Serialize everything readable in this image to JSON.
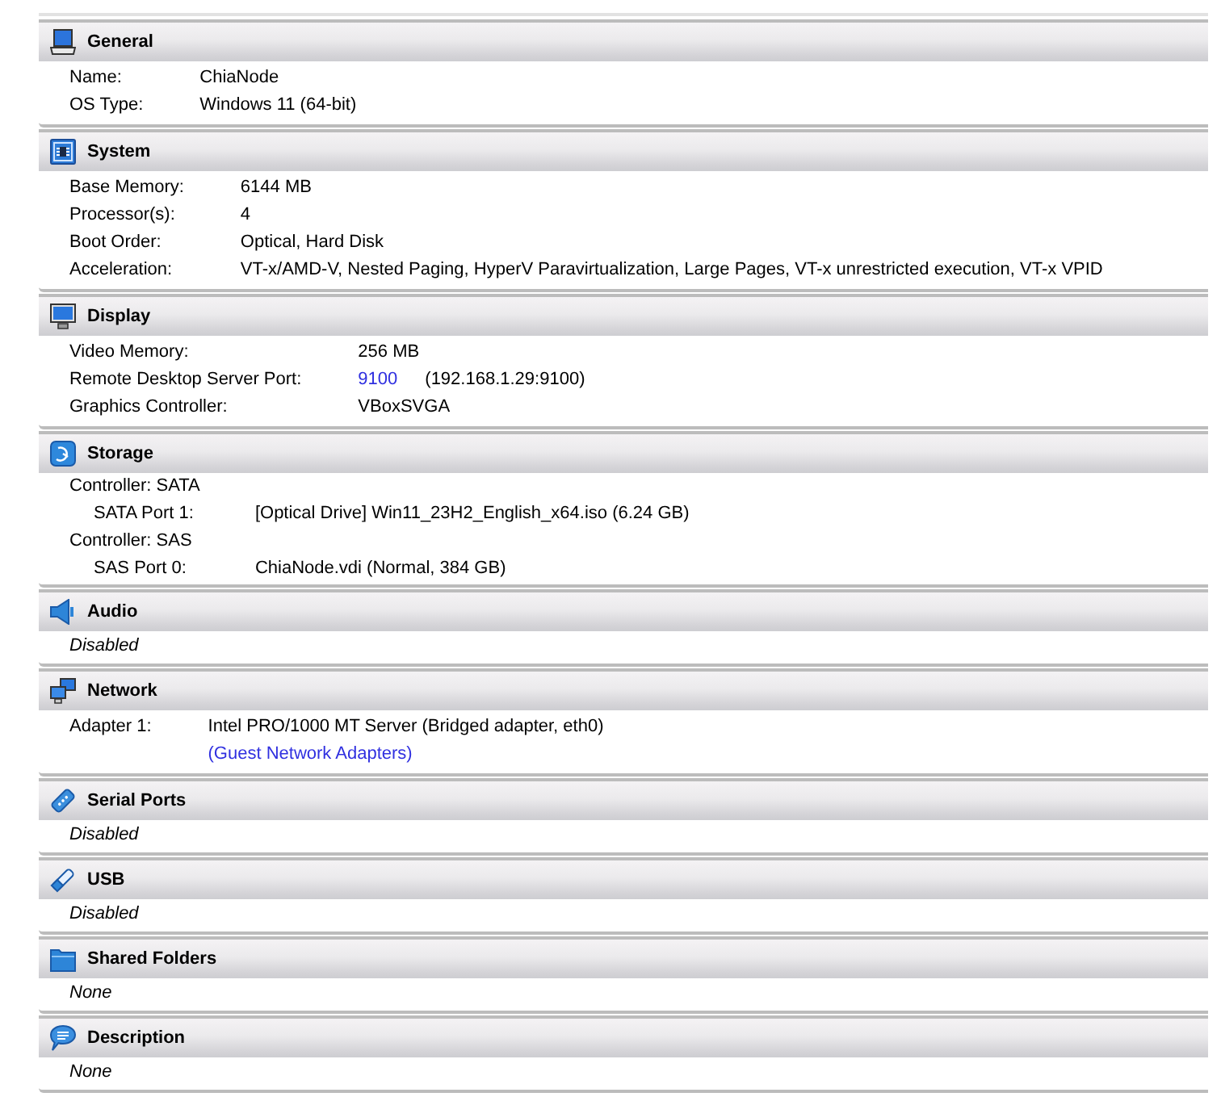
{
  "sections": [
    {
      "kind": "table",
      "title": "General",
      "rows": [
        {
          "label": "Name:",
          "value": "ChiaNode"
        },
        {
          "label": "OS Type:",
          "value": "Windows 11 (64-bit)"
        }
      ]
    },
    {
      "kind": "table",
      "title": "System",
      "rows": [
        {
          "label": "Base Memory:",
          "value": "6144 MB"
        },
        {
          "label": "Processor(s):",
          "value": "4"
        },
        {
          "label": "Boot Order:",
          "value": "Optical, Hard Disk"
        },
        {
          "label": "Acceleration:",
          "value": "VT-x/AMD-V, Nested Paging, HyperV Paravirtualization, Large Pages, VT-x unrestricted execution, VT-x VPID"
        }
      ]
    },
    {
      "kind": "table",
      "title": "Display",
      "rows": [
        {
          "label": "Video Memory:",
          "value": "256 MB",
          "link": false
        },
        {
          "label": "Remote Desktop Server Port:",
          "value": "9100",
          "link": true,
          "detail": "(192.168.1.29:9100)"
        },
        {
          "label": "Graphics Controller:",
          "value": "VBoxSVGA",
          "link": false
        }
      ]
    },
    {
      "kind": "tree",
      "title": "Storage",
      "controllers": [
        {
          "label": "Controller: SATA",
          "children": [
            {
              "label": "SATA Port 1:",
              "value": "[Optical Drive] Win11_23H2_English_x64.iso (6.24 GB)"
            }
          ]
        },
        {
          "label": "Controller: SAS",
          "children": [
            {
              "label": "SAS Port 0:",
              "value": "ChiaNode.vdi (Normal, 384 GB)"
            }
          ]
        }
      ]
    },
    {
      "kind": "note",
      "title": "Audio",
      "text": "Disabled"
    },
    {
      "kind": "table",
      "title": "Network",
      "rows": [
        {
          "label": "Adapter 1:",
          "value": "Intel PRO/1000 MT Server (Bridged adapter, eth0)",
          "link": false
        },
        {
          "value": "(Guest Network Adapters)",
          "link": true
        }
      ]
    },
    {
      "kind": "note",
      "title": "Serial Ports",
      "text": "Disabled"
    },
    {
      "kind": "note",
      "title": "USB",
      "text": "Disabled"
    },
    {
      "kind": "note",
      "title": "Shared Folders",
      "text": "None"
    },
    {
      "kind": "note",
      "title": "Description",
      "text": "None"
    }
  ]
}
